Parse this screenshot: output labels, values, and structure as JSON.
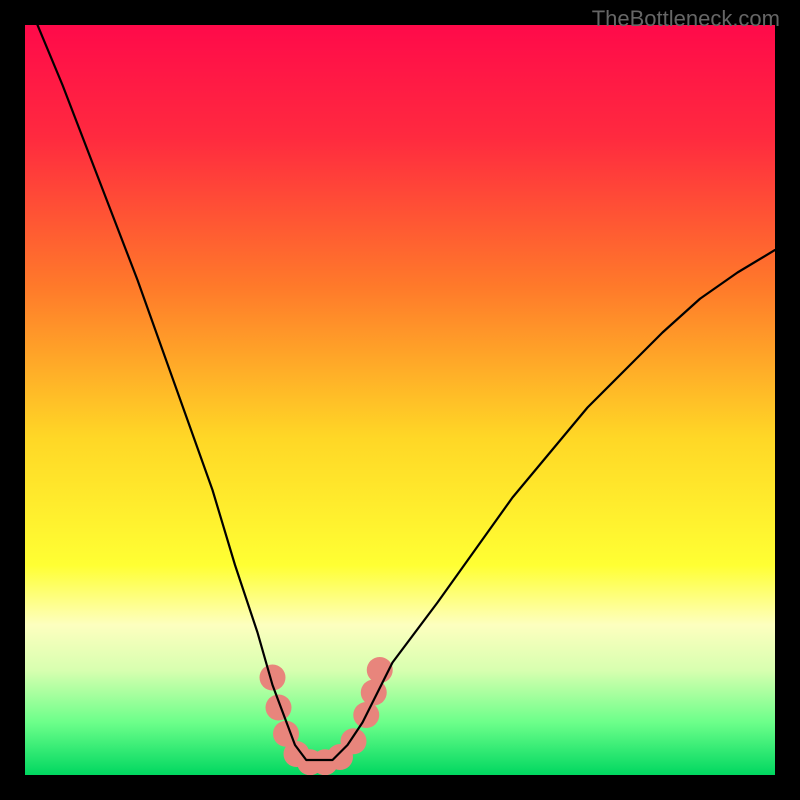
{
  "watermark": "TheBottleneck.com",
  "chart_data": {
    "type": "line",
    "title": "",
    "xlabel": "",
    "ylabel": "",
    "xlim": [
      0,
      100
    ],
    "ylim": [
      0,
      100
    ],
    "grid": false,
    "axes_visible": false,
    "background_gradient": {
      "stops": [
        {
          "offset": 0.0,
          "color": "#ff0a4a"
        },
        {
          "offset": 0.15,
          "color": "#ff2a3f"
        },
        {
          "offset": 0.35,
          "color": "#ff7a2a"
        },
        {
          "offset": 0.55,
          "color": "#ffd726"
        },
        {
          "offset": 0.72,
          "color": "#ffff33"
        },
        {
          "offset": 0.8,
          "color": "#fdffbf"
        },
        {
          "offset": 0.86,
          "color": "#d8ffb0"
        },
        {
          "offset": 0.93,
          "color": "#6cff8a"
        },
        {
          "offset": 1.0,
          "color": "#00d760"
        }
      ]
    },
    "series": [
      {
        "name": "bottleneck-curve",
        "color": "#000000",
        "x": [
          0,
          5,
          10,
          15,
          20,
          25,
          28,
          31,
          33,
          34.5,
          36,
          37.5,
          39,
          41,
          43,
          45,
          47,
          49,
          55,
          60,
          65,
          70,
          75,
          80,
          85,
          90,
          95,
          100
        ],
        "values": [
          104,
          92,
          79,
          66,
          52,
          38,
          28,
          19,
          12,
          8,
          4,
          2,
          2,
          2,
          4,
          7,
          11,
          15,
          23,
          30,
          37,
          43,
          49,
          54,
          59,
          63.5,
          67,
          70
        ]
      }
    ],
    "markers": {
      "name": "highlight-dots",
      "color": "#e8857c",
      "radius_px": 13,
      "points": [
        {
          "x": 33.0,
          "y": 13
        },
        {
          "x": 33.8,
          "y": 9
        },
        {
          "x": 34.8,
          "y": 5.5
        },
        {
          "x": 36.2,
          "y": 2.8
        },
        {
          "x": 38.0,
          "y": 1.7
        },
        {
          "x": 40.0,
          "y": 1.7
        },
        {
          "x": 42.0,
          "y": 2.4
        },
        {
          "x": 43.8,
          "y": 4.5
        },
        {
          "x": 45.5,
          "y": 8
        },
        {
          "x": 46.5,
          "y": 11
        },
        {
          "x": 47.3,
          "y": 14
        }
      ]
    }
  }
}
